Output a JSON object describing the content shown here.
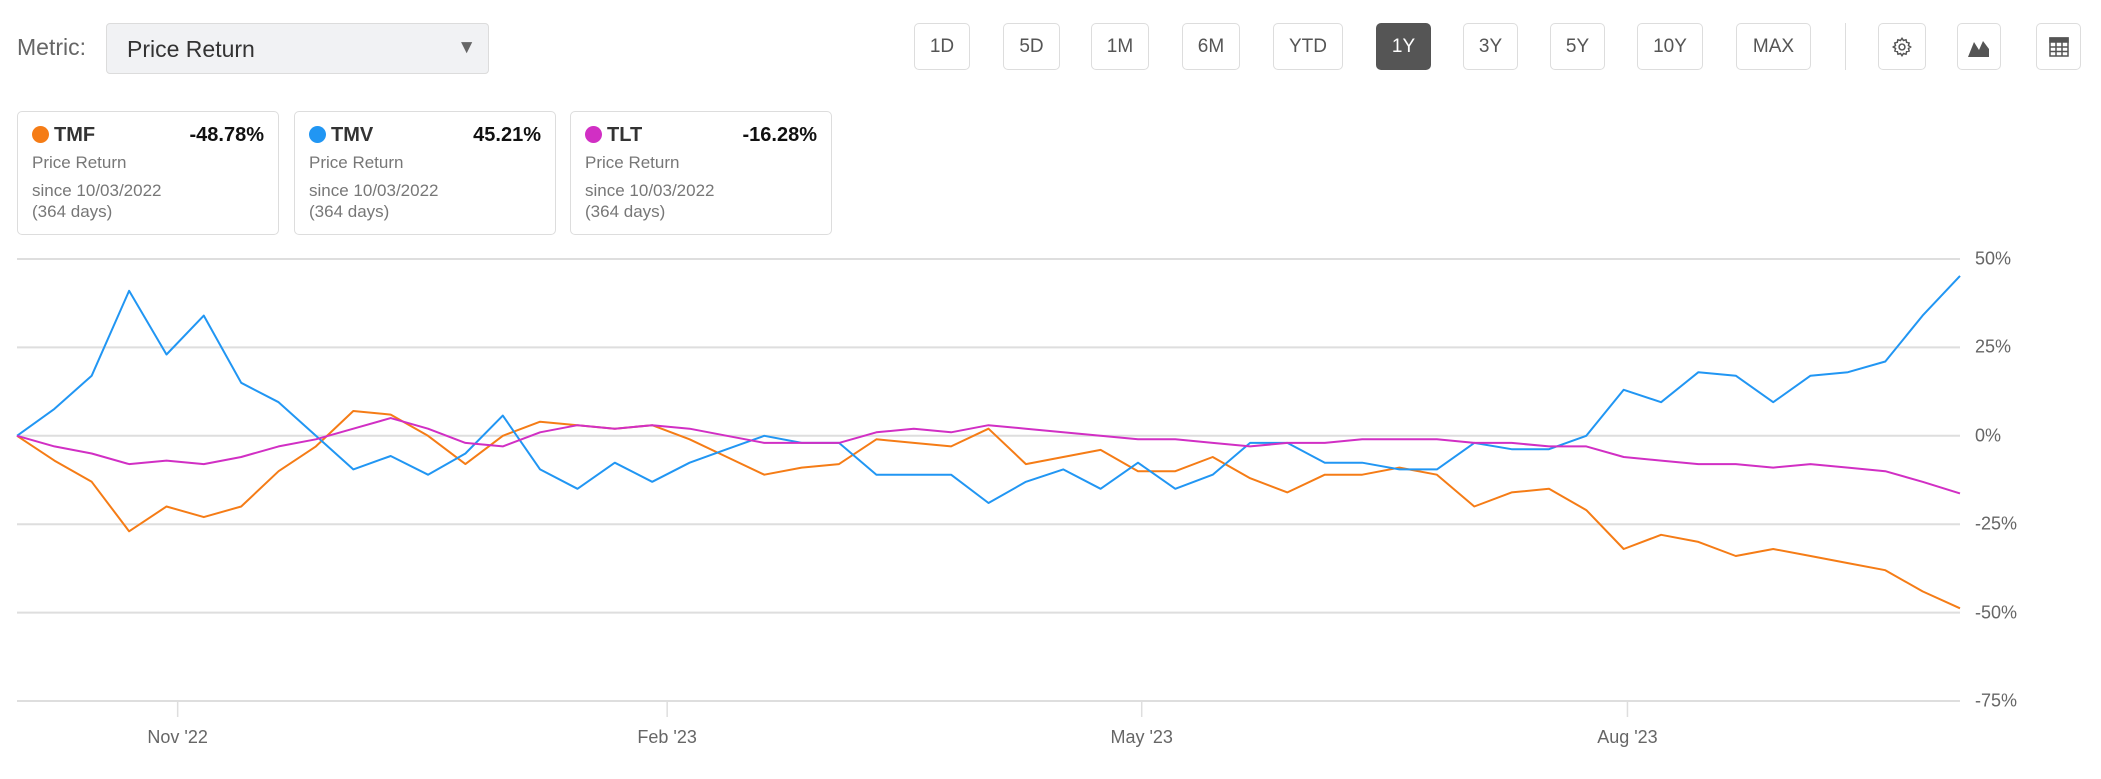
{
  "toolbar": {
    "metric_label": "Metric:",
    "metric_value": "Price Return",
    "ranges": [
      "1D",
      "5D",
      "1M",
      "6M",
      "YTD",
      "1Y",
      "3Y",
      "5Y",
      "10Y",
      "MAX"
    ],
    "active_range": "1Y",
    "icons": [
      "gear-icon",
      "chart-type-icon",
      "table-icon"
    ]
  },
  "cards": [
    {
      "symbol": "TMF",
      "value": "-48.78%",
      "metric": "Price Return",
      "since": "since 10/03/2022",
      "days": "(364 days)",
      "color": "#f57c16"
    },
    {
      "symbol": "TMV",
      "value": "45.21%",
      "metric": "Price Return",
      "since": "since 10/03/2022",
      "days": "(364 days)",
      "color": "#2196f3"
    },
    {
      "symbol": "TLT",
      "value": "-16.28%",
      "metric": "Price Return",
      "since": "since 10/03/2022",
      "days": "(364 days)",
      "color": "#d12fc4"
    }
  ],
  "chart_data": {
    "type": "line",
    "title": "",
    "xlabel": "",
    "ylabel": "",
    "x_unit": "weeks since 10/03/2022",
    "x": [
      0,
      1,
      2,
      3,
      4,
      5,
      6,
      7,
      8,
      9,
      10,
      11,
      12,
      13,
      14,
      15,
      16,
      17,
      18,
      19,
      20,
      21,
      22,
      23,
      24,
      25,
      26,
      27,
      28,
      29,
      30,
      31,
      32,
      33,
      34,
      35,
      36,
      37,
      38,
      39,
      40,
      41,
      42,
      43,
      44,
      45,
      46,
      47,
      48,
      49,
      50,
      51,
      52
    ],
    "x_ticks": [
      {
        "label": "Nov '22",
        "week": 4.3
      },
      {
        "label": "Feb '23",
        "week": 17.4
      },
      {
        "label": "May '23",
        "week": 30.1
      },
      {
        "label": "Aug '23",
        "week": 43.1
      }
    ],
    "y_ticks": [
      "50%",
      "25%",
      "0%",
      "-25%",
      "-50%",
      "-75%"
    ],
    "y_tick_values": [
      50,
      25,
      0,
      -25,
      -50,
      -75
    ],
    "ylim": [
      -75,
      50
    ],
    "grid": true,
    "axis_position": "right",
    "series": [
      {
        "name": "TMF",
        "color": "#f57c16",
        "values": [
          0,
          -7,
          -13,
          -27,
          -20,
          -23,
          -20,
          -10,
          -3,
          7,
          6,
          0,
          -8,
          0,
          4,
          3,
          2,
          3,
          -1,
          -6,
          -11,
          -9,
          -8,
          -1,
          -2,
          -3,
          2,
          -8,
          -6,
          -4,
          -10,
          -10,
          -6,
          -12,
          -16,
          -11,
          -11,
          -9,
          -11,
          -20,
          -16,
          -15,
          -21,
          -32,
          -28,
          -30,
          -34,
          -32,
          -34,
          -36,
          -38,
          -44,
          -48.78
        ]
      },
      {
        "name": "TMV",
        "color": "#2196f3",
        "values": [
          0,
          7.6,
          17,
          41,
          23,
          34,
          15,
          9.5,
          0,
          -9.5,
          -5.7,
          -11,
          -5,
          5.7,
          -9.5,
          -15,
          -7.6,
          -13,
          -7.6,
          -3.8,
          0,
          -2,
          -2,
          -11,
          -11,
          -11,
          -19,
          -13,
          -9.5,
          -15,
          -7.6,
          -15,
          -11,
          -2,
          -2,
          -7.6,
          -7.6,
          -9.5,
          -9.5,
          -2,
          -3.8,
          -3.8,
          0,
          13,
          9.5,
          18,
          17,
          9.5,
          17,
          18,
          21,
          34,
          45.21
        ]
      },
      {
        "name": "TLT",
        "color": "#d12fc4",
        "values": [
          0,
          -3,
          -5,
          -8,
          -7,
          -8,
          -6,
          -3,
          -1,
          2,
          5,
          2,
          -2,
          -3,
          1,
          3,
          2,
          3,
          2,
          0,
          -2,
          -2,
          -2,
          1,
          2,
          1,
          3,
          2,
          1,
          0,
          -1,
          -1,
          -2,
          -3,
          -2,
          -2,
          -1,
          -1,
          -1,
          -2,
          -2,
          -3,
          -3,
          -6,
          -7,
          -8,
          -8,
          -9,
          -8,
          -9,
          -10,
          -13,
          -16.28
        ]
      }
    ]
  }
}
